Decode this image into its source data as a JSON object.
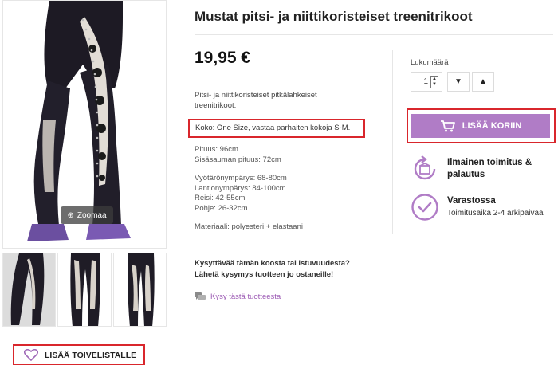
{
  "product": {
    "title": "Mustat pitsi- ja niittikoristeiset treenitrikoot",
    "price": "19,95 €",
    "description": "Pitsi- ja niittikoristeiset pitkälahkeiset treenitrikoot.",
    "size_note": "Koko: One Size, vastaa parhaiten kokoja S-M.",
    "specs": {
      "inseam_outer": "Pituus: 96cm",
      "inseam_inner": "Sisäsauman pituus: 72cm",
      "waist": "Vyötärönympärys: 68-80cm",
      "hips": "Lantionympärys: 84-100cm",
      "thigh": "Reisi: 42-55cm",
      "hem": "Pohje: 26-32cm",
      "material": "Materiaali: polyesteri + elastaani"
    },
    "question_line1": "Kysyttävää tämän koosta tai istuvuudesta?",
    "question_line2": "Lähetä kysymys tuotteen jo ostaneille!",
    "ask_link": "Kysy tästä tuotteesta"
  },
  "gallery": {
    "zoom_label": "Zoomaa",
    "thumbnail_count": 3,
    "active_thumbnail": 1,
    "wishlist_label": "LISÄÄ TOIVELISTALLE"
  },
  "purchase": {
    "quantity_label": "Lukumäärä",
    "quantity_value": "1",
    "add_to_cart_label": "LISÄÄ KORIIN"
  },
  "features": [
    {
      "icon": "free-shipping-return-icon",
      "title": "Ilmainen toimitus & palautus",
      "subtitle": ""
    },
    {
      "icon": "in-stock-check-icon",
      "title": "Varastossa",
      "subtitle": "Toimitusaika 2-4 arkipäivää"
    }
  ],
  "colors": {
    "accent_purple": "#b07cc6",
    "highlight_red": "#d9262c",
    "link_purple": "#9c5ab4"
  }
}
